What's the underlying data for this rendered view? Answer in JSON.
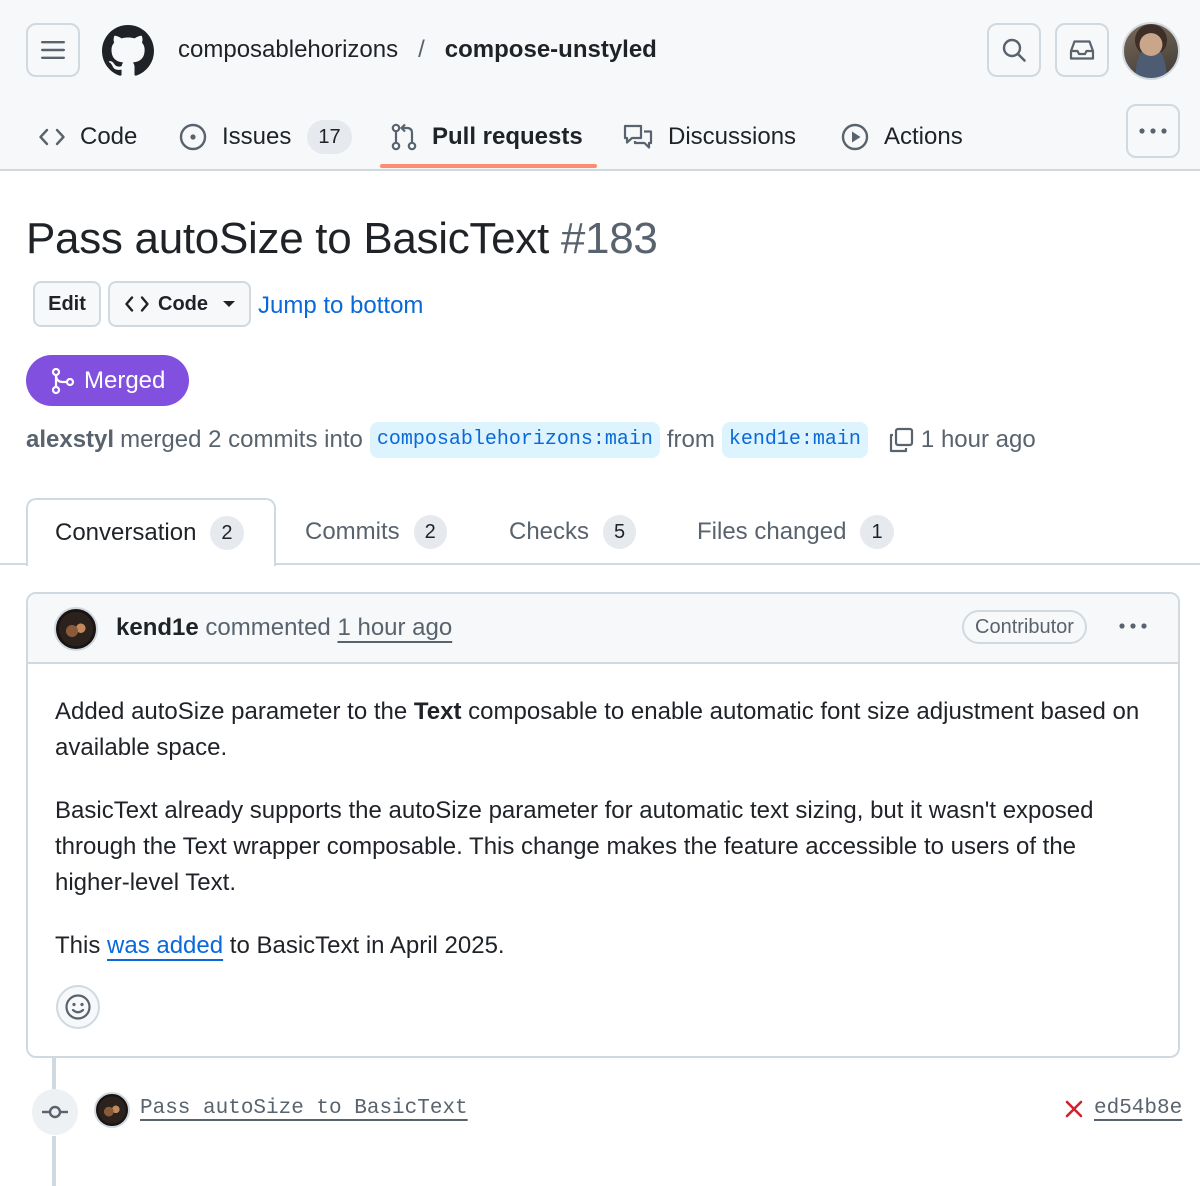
{
  "repo": {
    "owner": "composablehorizons",
    "separator": "/",
    "name": "compose-unstyled"
  },
  "nav": {
    "tabs": [
      {
        "label": "Code",
        "icon": "code-icon"
      },
      {
        "label": "Issues",
        "icon": "issue-opened-icon",
        "count": "17"
      },
      {
        "label": "Pull requests",
        "icon": "git-pull-request-icon",
        "selected": true
      },
      {
        "label": "Discussions",
        "icon": "comment-discussion-icon"
      },
      {
        "label": "Actions",
        "icon": "play-icon"
      }
    ]
  },
  "pr": {
    "title": "Pass autoSize to BasicText",
    "number": "#183",
    "edit_label": "Edit",
    "code_label": "Code",
    "jump_label": "Jump to bottom",
    "state": "Merged",
    "state_color": "#8250df",
    "meta": {
      "author": "alexstyl",
      "action": "merged 2 commits into",
      "base_branch": "composablehorizons:main",
      "from_word": "from",
      "head_branch": "kend1e:main",
      "time": "1 hour ago"
    }
  },
  "pr_tabs": [
    {
      "label": "Conversation",
      "count": "2",
      "active": true
    },
    {
      "label": "Commits",
      "count": "2"
    },
    {
      "label": "Checks",
      "count": "5"
    },
    {
      "label": "Files changed",
      "count": "1"
    }
  ],
  "comment": {
    "author": "kend1e",
    "verb": "commented",
    "time": "1 hour ago",
    "role_badge": "Contributor",
    "p1_before": "Added autoSize parameter to the ",
    "p1_bold": "Text",
    "p1_after": " composable to enable automatic font size adjustment based on available space.",
    "p2": "BasicText already supports the autoSize parameter for automatic text sizing, but it wasn't exposed through the Text wrapper composable. This change makes the feature accessible to users of the higher-level Text.",
    "p3_before": "This ",
    "p3_link": "was added",
    "p3_after": " to BasicText in April 2025."
  },
  "timeline": {
    "commit_message": "Pass autoSize to BasicText",
    "status": "failure",
    "status_color": "#cf222e",
    "sha": "ed54b8e"
  },
  "colors": {
    "accent_link": "#0969da",
    "tab_underline": "#fd8c73",
    "merged": "#8250df"
  }
}
